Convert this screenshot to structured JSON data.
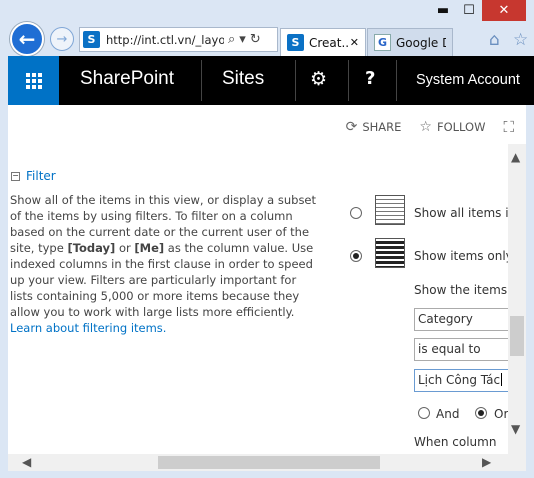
{
  "browser": {
    "window_controls": {
      "minimize": "▬",
      "maximize": "☐",
      "close": "✕"
    },
    "address_url": "http://int.ctl.vn/_layou",
    "tabs": [
      {
        "label": "Creat...",
        "favicon": "S"
      },
      {
        "label": "Google D...",
        "favicon": "G"
      }
    ]
  },
  "suitebar": {
    "brand": "SharePoint",
    "sites": "Sites",
    "account": "System Account"
  },
  "actions": {
    "share": "SHARE",
    "follow": "FOLLOW"
  },
  "filter": {
    "title": "Filter",
    "desc_1": "Show all of the items in this view, or display a subset of the items by using filters. To filter on a column based on the current date or the current user of the site, type ",
    "today": "[Today]",
    "desc_or": " or ",
    "me": "[Me]",
    "desc_2": " as the column value. Use indexed columns in the first clause in order to speed up your view. Filters are particularly important for lists containing 5,000 or more items because they allow you to work with large lists more efficiently. ",
    "learn_link": "Learn about filtering items.",
    "options": {
      "show_all": "Show all items in",
      "show_only": "Show items only",
      "show_when": "Show the items w"
    },
    "column": "Category",
    "operator": "is equal to",
    "value": "Lịch Công Tác",
    "and_label": "And",
    "or_label": "Or",
    "when_column": "When column"
  },
  "colors": {
    "accent": "#0072c6",
    "suitebar": "#000000",
    "close": "#c7372f"
  }
}
